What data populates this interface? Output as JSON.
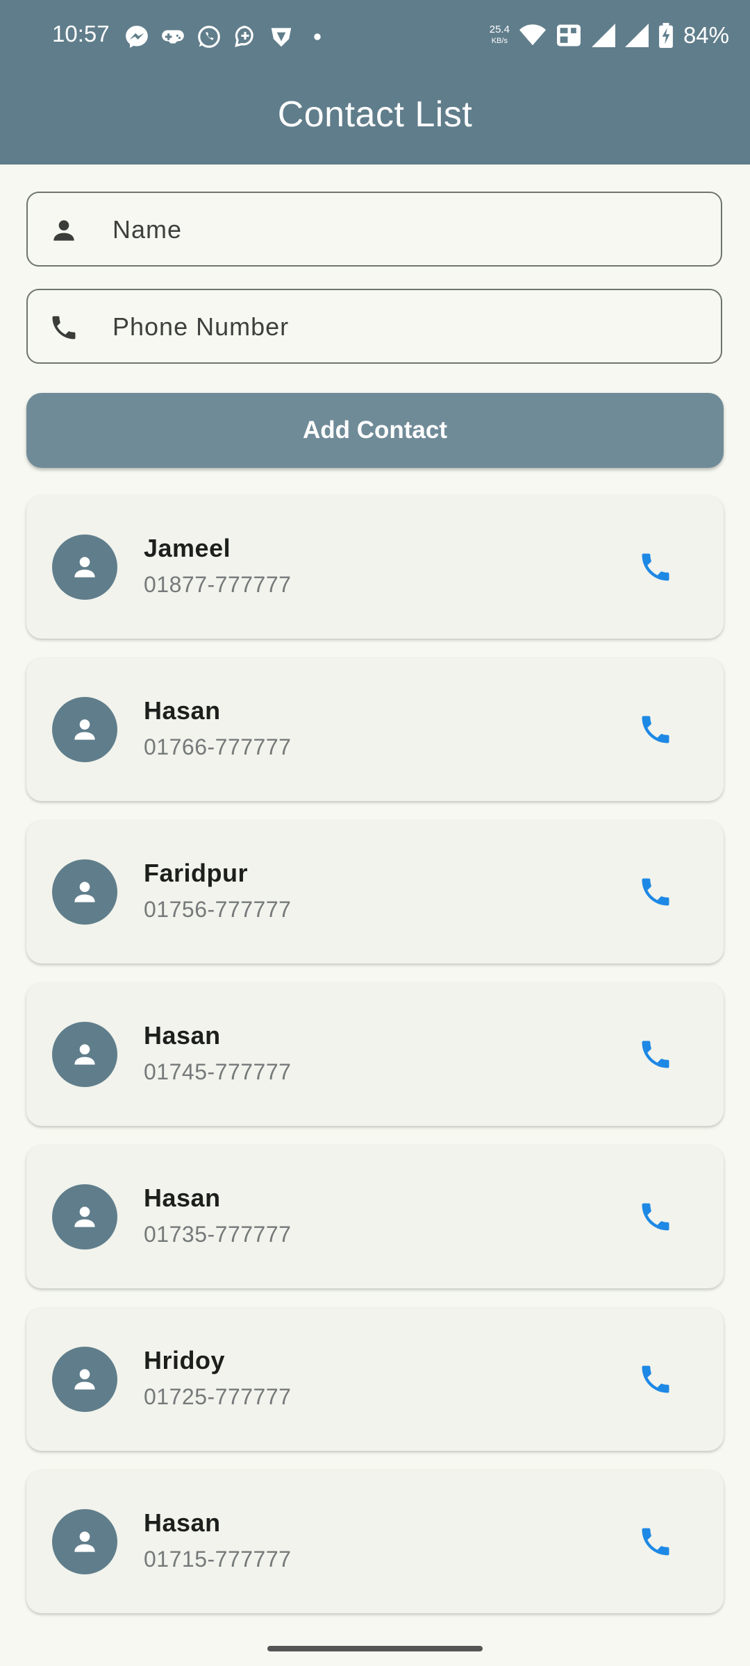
{
  "status_bar": {
    "time": "10:57",
    "net_speed_value": "25.4",
    "net_speed_unit": "KB/s",
    "battery": "84%"
  },
  "app_bar": {
    "title": "Contact List"
  },
  "form": {
    "name_placeholder": "Name",
    "phone_placeholder": "Phone Number",
    "add_button_label": "Add Contact"
  },
  "contacts": [
    {
      "name": "Jameel",
      "phone": "01877-777777"
    },
    {
      "name": "Hasan",
      "phone": "01766-777777"
    },
    {
      "name": "Faridpur",
      "phone": "01756-777777"
    },
    {
      "name": "Hasan",
      "phone": "01745-777777"
    },
    {
      "name": "Hasan",
      "phone": "01735-777777"
    },
    {
      "name": "Hridoy",
      "phone": "01725-777777"
    },
    {
      "name": "Hasan",
      "phone": "01715-777777"
    }
  ],
  "colors": {
    "app_bar": "#607d8b",
    "button": "#708b98",
    "call_icon": "#1e88e5",
    "background": "#f6f8f1"
  },
  "icons": {
    "name_field": "person-icon",
    "phone_field": "phone-icon",
    "avatar": "person-icon",
    "call": "phone-icon"
  }
}
